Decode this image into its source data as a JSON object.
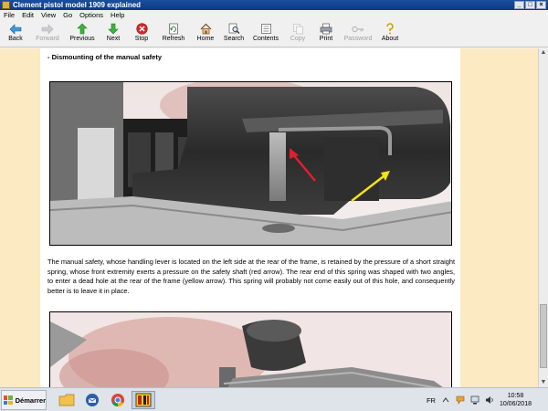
{
  "window": {
    "title": "Clement pistol model 1909 explained",
    "controls": {
      "minimize": "_",
      "maximize": "□",
      "close": "×"
    }
  },
  "menu": [
    "File",
    "Edit",
    "View",
    "Go",
    "Options",
    "Help"
  ],
  "toolbar": {
    "back": "Back",
    "forward": "Forward",
    "previous": "Previous",
    "next": "Next",
    "stop": "Stop",
    "refresh": "Refresh",
    "home": "Home",
    "search": "Search",
    "contents": "Contents",
    "copy": "Copy",
    "print": "Print",
    "password": "Password",
    "about": "About"
  },
  "page": {
    "section_title": "- Dismounting of the manual safety",
    "caption": "The manual safety, whose handling lever is located on the left side at the rear of the frame, is retained by the pressure of a short straight spring, whose front extremity exerts a pressure on the safety shaft (red arrow). The rear end of this spring was shaped with two angles, to enter a dead hole at the rear of the frame (yellow arrow). This spring will probably not come easily out of this hole, and consequently better is to leave it in place."
  },
  "taskbar": {
    "start_label": "Démarrer",
    "language": "FR",
    "time": "10:58",
    "date": "10/06/2018"
  },
  "colors": {
    "title_bar": "#0b3a86",
    "page_background": "#fbeac2",
    "red_arrow": "#e0202a",
    "yellow_arrow": "#f2e21a"
  }
}
